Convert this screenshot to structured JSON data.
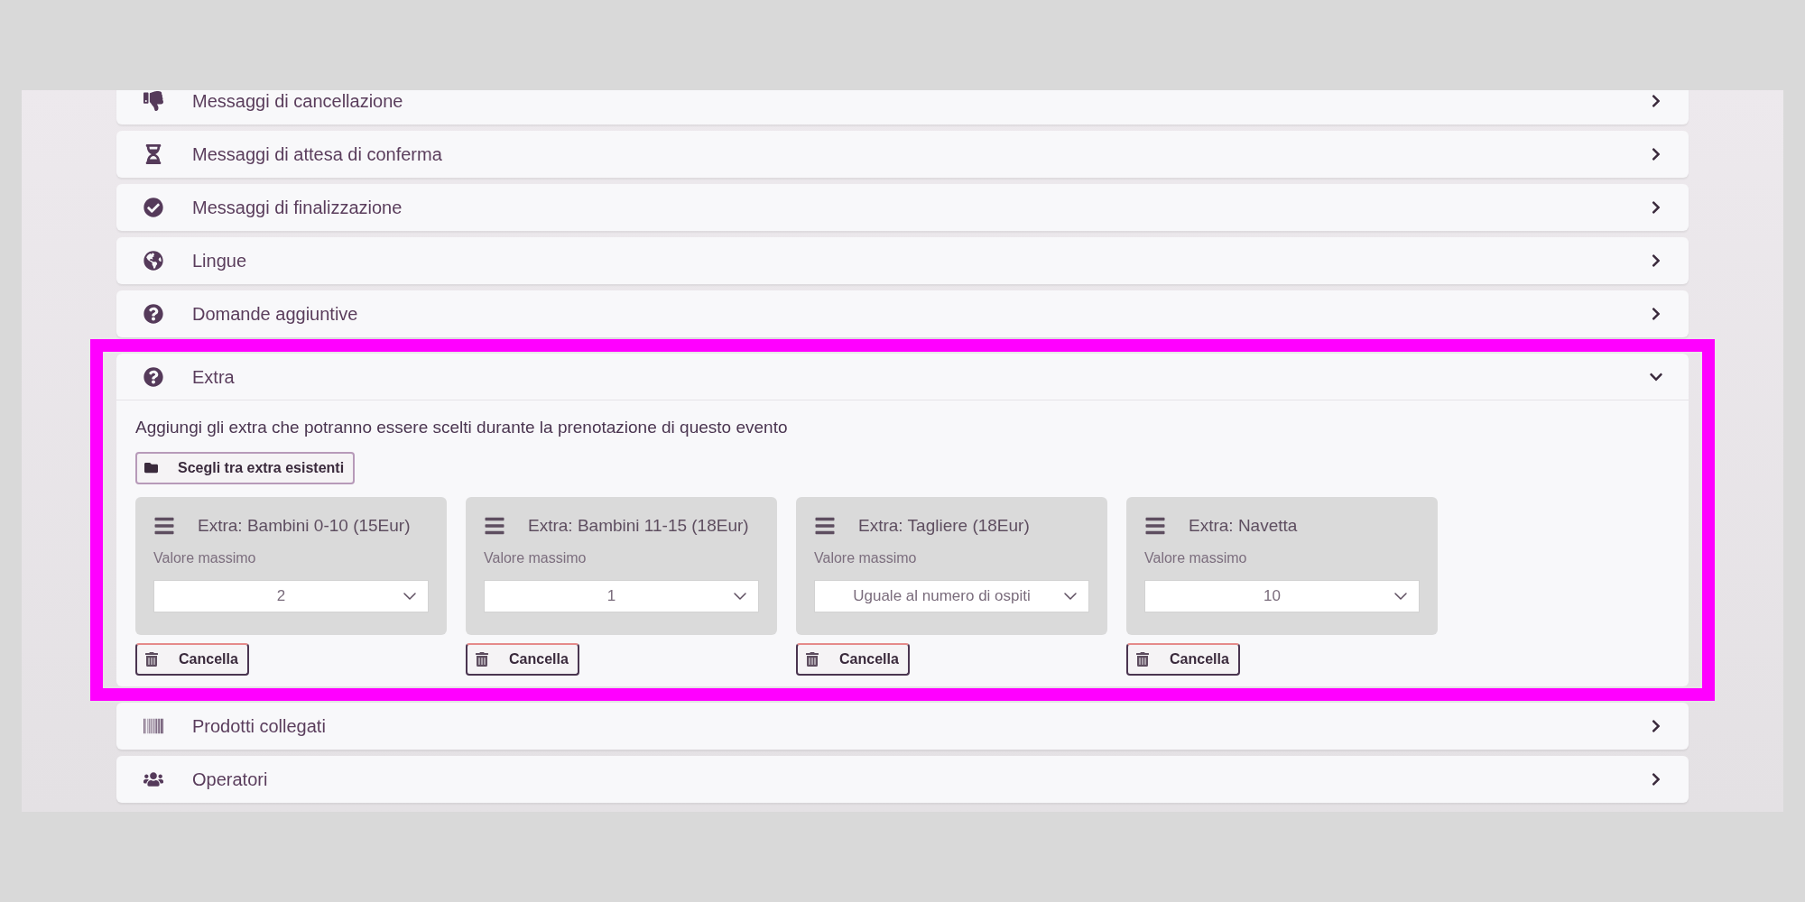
{
  "sections": [
    {
      "title": "Messaggi di cancellazione",
      "expanded": false
    },
    {
      "title": "Messaggi di attesa di conferma",
      "expanded": false
    },
    {
      "title": "Messaggi di finalizzazione",
      "expanded": false
    },
    {
      "title": "Lingue",
      "expanded": false
    },
    {
      "title": "Domande aggiuntive",
      "expanded": false
    },
    {
      "title": "Extra",
      "expanded": true,
      "highlighted": true,
      "description": "Aggiungi gli extra che potranno essere scelti durante la prenotazione di questo evento",
      "choose_button": "Scegli tra extra esistenti",
      "extras": [
        {
          "title": "Extra: Bambini 0-10 (15Eur)",
          "field_label": "Valore massimo",
          "value": "2",
          "delete_button": "Cancella"
        },
        {
          "title": "Extra: Bambini 11-15 (18Eur)",
          "field_label": "Valore massimo",
          "value": "1",
          "delete_button": "Cancella"
        },
        {
          "title": "Extra: Tagliere (18Eur)",
          "field_label": "Valore massimo",
          "value": "Uguale al numero di ospiti",
          "delete_button": "Cancella"
        },
        {
          "title": "Extra: Navetta",
          "field_label": "Valore massimo",
          "value": "10",
          "delete_button": "Cancella"
        }
      ]
    },
    {
      "title": "Prodotti collegati",
      "expanded": false
    },
    {
      "title": "Operatori",
      "expanded": false
    }
  ]
}
